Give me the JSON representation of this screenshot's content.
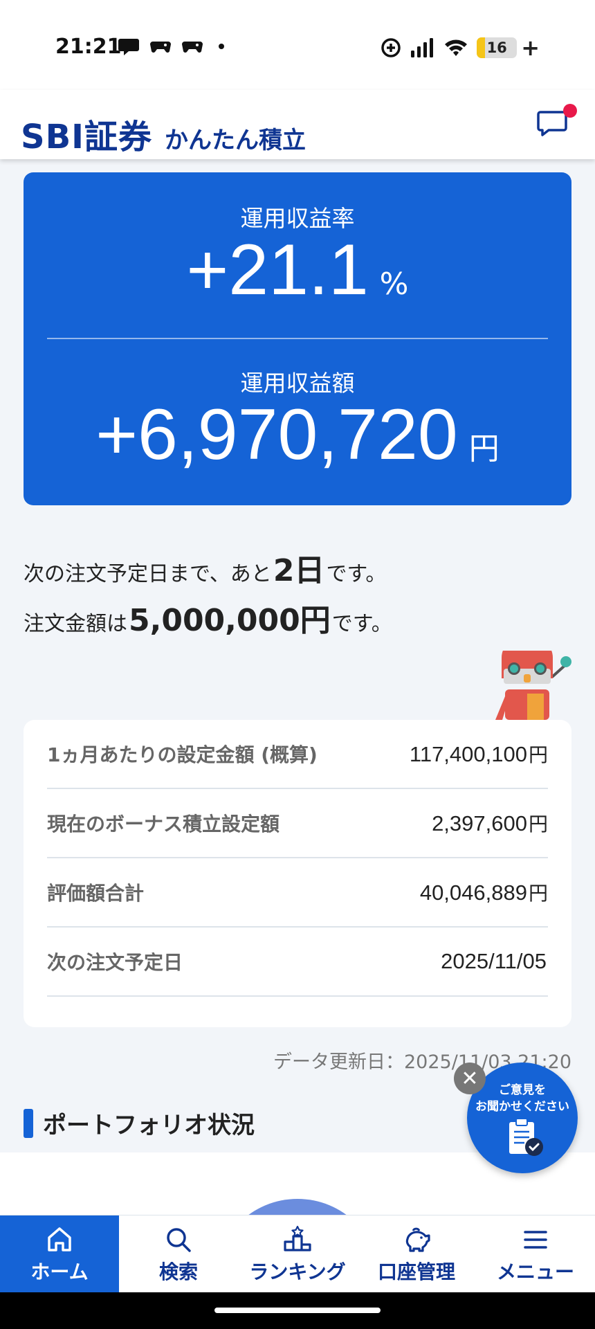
{
  "status_bar": {
    "time": "21:21",
    "battery_level": "16",
    "battery_charging": "+"
  },
  "header": {
    "brand": "SBI証券",
    "subtitle": "かんたん積立"
  },
  "summary": {
    "rate_label": "運用収益率",
    "rate_value": "+21.1",
    "rate_unit": "%",
    "amount_label": "運用収益額",
    "amount_value": "+6,970,720",
    "amount_unit": "円"
  },
  "next_order": {
    "line1_prefix": "次の注文予定日まで、あと",
    "line1_days": "2日",
    "line1_suffix": "です。",
    "line2_prefix": "注文金額は",
    "line2_amount": "5,000,000円",
    "line2_suffix": "です。"
  },
  "info": {
    "rows": [
      {
        "label": "1ヵ月あたりの設定金額 (概算)",
        "value": "117,400,100",
        "unit": "円"
      },
      {
        "label": "現在のボーナス積立設定額",
        "value": "2,397,600",
        "unit": "円"
      },
      {
        "label": "評価額合計",
        "value": "40,046,889",
        "unit": "円"
      },
      {
        "label": "次の注文予定日",
        "value": "2025/11/05",
        "unit": ""
      }
    ]
  },
  "updated": "データ更新日：2025/11/03 21:20",
  "portfolio": {
    "title": "ポートフォリオ状況"
  },
  "feedback": {
    "line1": "ご意見を",
    "line2": "お聞かせください",
    "close": "✕"
  },
  "nav": {
    "items": [
      {
        "label": "ホーム",
        "icon": "home-icon",
        "active": true
      },
      {
        "label": "検索",
        "icon": "search-icon",
        "active": false
      },
      {
        "label": "ランキング",
        "icon": "ranking-icon",
        "active": false
      },
      {
        "label": "口座管理",
        "icon": "piggy-bank-icon",
        "active": false
      },
      {
        "label": "メニュー",
        "icon": "menu-icon",
        "active": false
      }
    ]
  },
  "colors": {
    "primary": "#1563d6",
    "brand_navy": "#0f3592",
    "badge_red": "#e8194a",
    "background": "#f2f5f9"
  }
}
